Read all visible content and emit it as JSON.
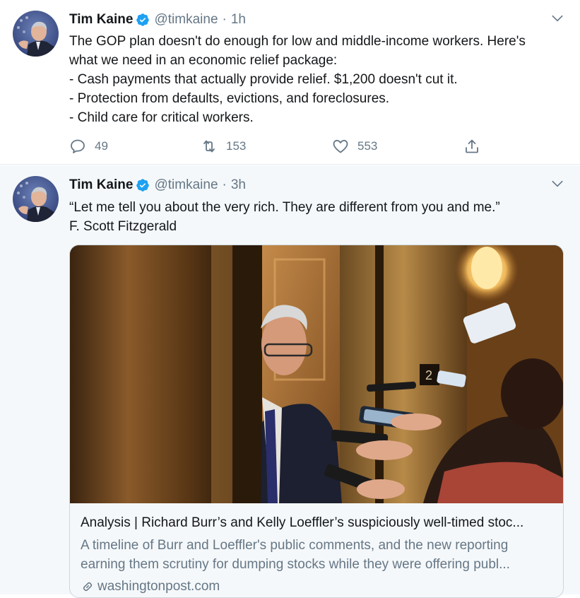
{
  "tweets": [
    {
      "name": "Tim Kaine",
      "handle": "@timkaine",
      "separator": "·",
      "time": "1h",
      "text_lines": [
        "The GOP plan doesn't do enough for low and middle-income workers. Here's",
        "what we need in an economic relief package:",
        "- Cash payments that actually provide relief. $1,200 doesn't cut it.",
        "- Protection from defaults, evictions, and foreclosures.",
        "- Child care for critical workers."
      ],
      "replies": "49",
      "retweets": "153",
      "likes": "553"
    },
    {
      "name": "Tim Kaine",
      "handle": "@timkaine",
      "separator": "·",
      "time": "3h",
      "text_lines": [
        "“Let me tell you about the very rich. They are different from you and me.”",
        "F. Scott Fitzgerald"
      ],
      "card": {
        "title": "Analysis | Richard Burr’s and Kelly Loeffler’s suspiciously well-timed stoc...",
        "description_lines": [
          "A timeline of Burr and Loeffler's public comments, and the new reporting",
          "earning them scrutiny for dumping stocks while they were offering publ..."
        ],
        "domain": "washingtonpost.com"
      }
    }
  ],
  "colors": {
    "text": "#14171a",
    "secondary": "#657786",
    "verified": "#1da1f2",
    "border": "#e6ecf0",
    "highlight_bg": "#f5f8fa"
  },
  "icons": [
    "verified-badge-icon",
    "chevron-down-icon",
    "reply-icon",
    "retweet-icon",
    "like-icon",
    "share-icon",
    "link-icon"
  ]
}
